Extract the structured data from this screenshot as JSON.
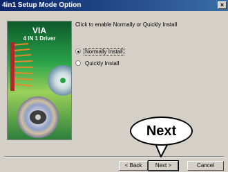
{
  "window": {
    "title": "4in1 Setup Mode Option"
  },
  "titlebar": {
    "close_glyph": "×",
    "close_icon": "close-icon"
  },
  "banner": {
    "brand": "VIA",
    "subtitle": "4 IN 1 Driver"
  },
  "content": {
    "heading": "Click to enable Normally or Quickly Install",
    "options": [
      {
        "label": "Normally Install",
        "selected": true
      },
      {
        "label": "Quickly Install",
        "selected": false
      }
    ]
  },
  "buttons": {
    "back": "< Back",
    "next": "Next >",
    "cancel": "Cancel"
  },
  "callout": {
    "text": "Next"
  },
  "colors": {
    "titlebar_start": "#0a246a",
    "titlebar_end": "#3a6ea5",
    "face": "#d4d0c8"
  }
}
